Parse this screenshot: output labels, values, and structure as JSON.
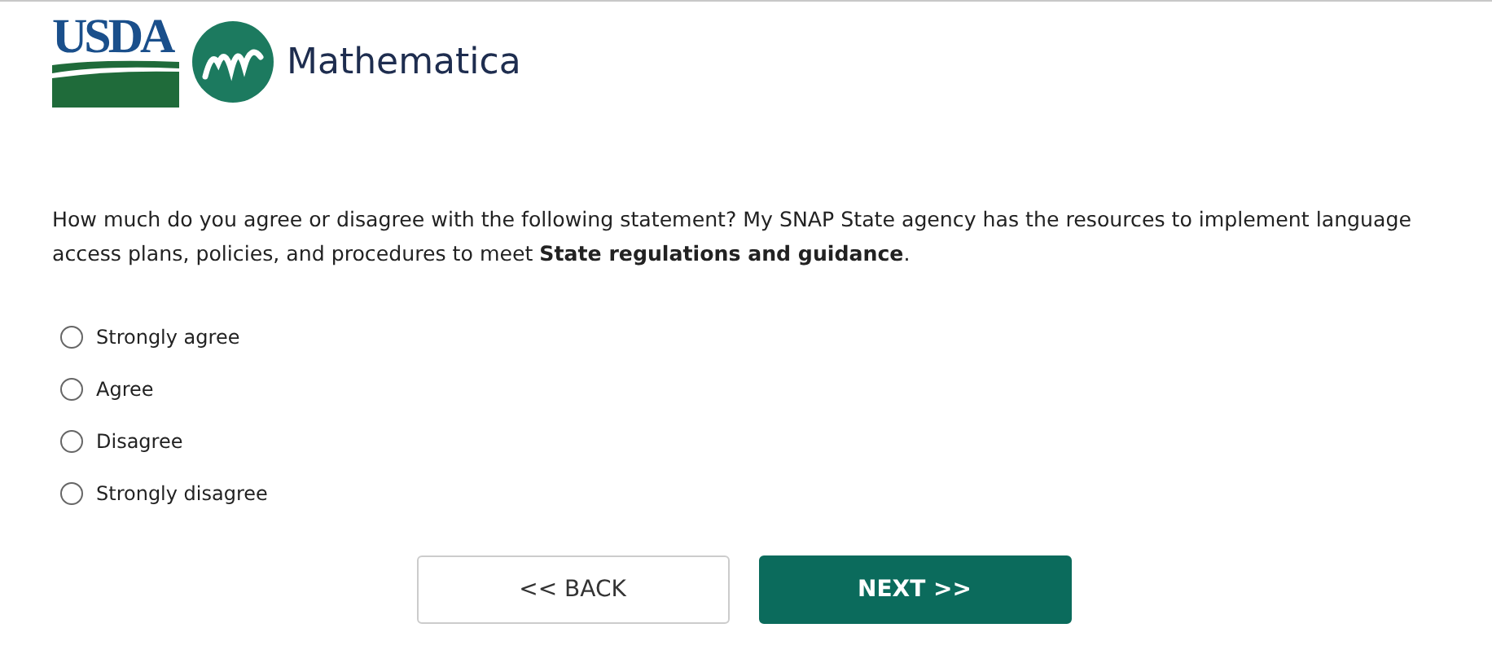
{
  "header": {
    "usda_logo": "USDA",
    "brand": "Mathematica"
  },
  "question": "How much do you agree or disagree with the following statement? My SNAP State agency has the resources to implement language access plans, policies, and procedures to meet **State regulations and guidance**.",
  "options": [
    {
      "label": "Strongly agree",
      "selected": false
    },
    {
      "label": "Agree",
      "selected": false
    },
    {
      "label": "Disagree",
      "selected": false
    },
    {
      "label": "Strongly disagree",
      "selected": false
    }
  ],
  "buttons": [
    {
      "kind": "back",
      "label": "<< BACK"
    },
    {
      "kind": "next",
      "label": "NEXT >>"
    }
  ]
}
